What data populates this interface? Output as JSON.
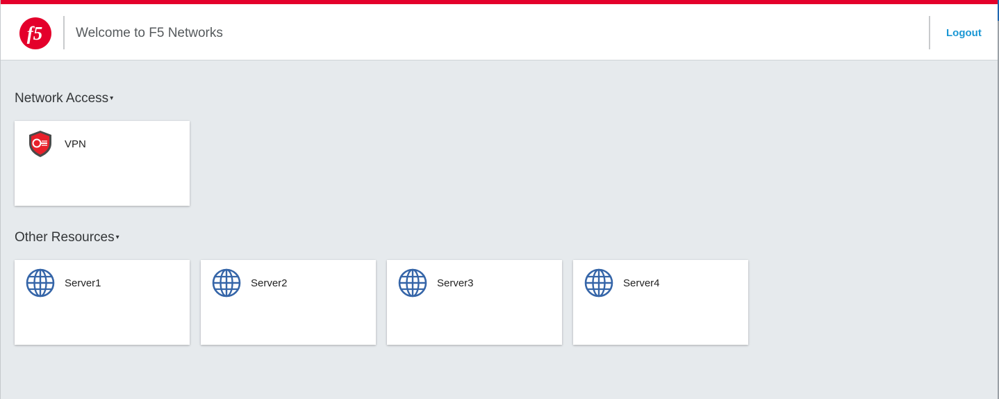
{
  "header": {
    "logo_text": "f5",
    "welcome": "Welcome to F5 Networks",
    "logout_label": "Logout"
  },
  "sections": [
    {
      "title": "Network Access",
      "caret": "▾",
      "items": [
        {
          "label": "VPN",
          "icon": "vpn-shield-icon"
        }
      ]
    },
    {
      "title": "Other Resources",
      "caret": "▾",
      "items": [
        {
          "label": "Server1",
          "icon": "globe-icon"
        },
        {
          "label": "Server2",
          "icon": "globe-icon"
        },
        {
          "label": "Server3",
          "icon": "globe-icon"
        },
        {
          "label": "Server4",
          "icon": "globe-icon"
        }
      ]
    }
  ],
  "colors": {
    "accent": "#e4002b",
    "link": "#1a97d4",
    "globe": "#3565a8",
    "background": "#e6eaed"
  }
}
